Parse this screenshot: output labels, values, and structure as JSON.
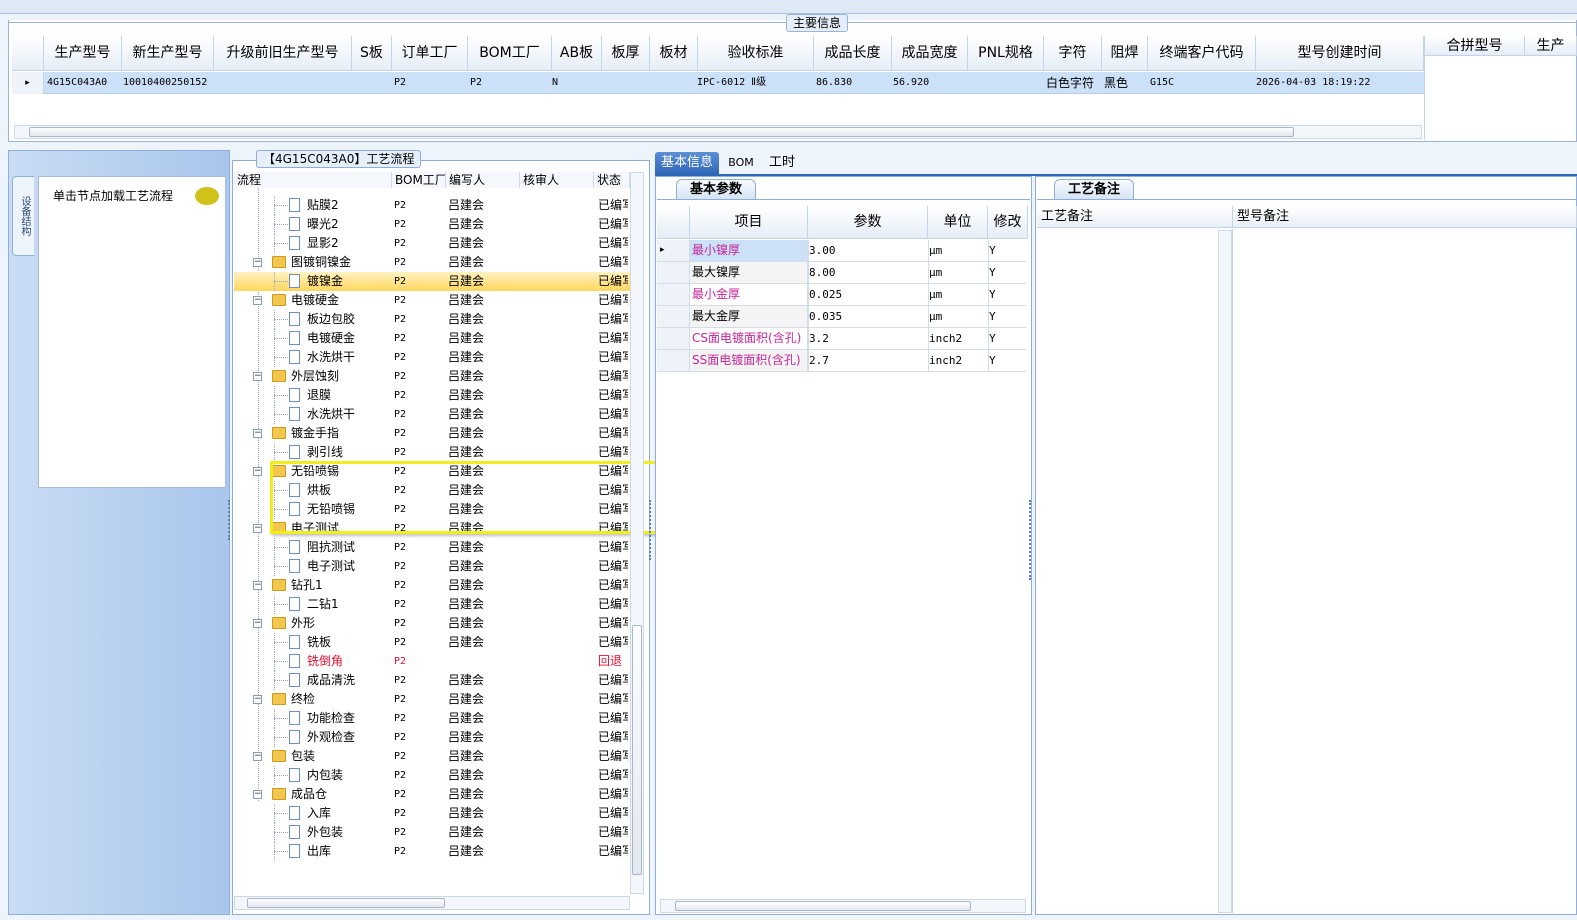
{
  "main": {
    "legend": "主要信息",
    "columns": [
      "生产型号",
      "新生产型号",
      "升级前旧生产型号",
      "S板",
      "订单工厂",
      "BOM工厂",
      "AB板",
      "板厚",
      "板材",
      "验收标准",
      "成品长度",
      "成品宽度",
      "PNL规格",
      "字符",
      "阻焊",
      "终端客户代码",
      "型号创建时间",
      "合拼型号",
      "生产"
    ],
    "row": {
      "marker": "▸",
      "prod_model": "4G15C043A0",
      "new_model": "10010400250152",
      "order_factory": "P2",
      "bom_factory": "P2",
      "ab": "N",
      "standard": "IPC-6012 Ⅱ级",
      "length": "86.830",
      "width": "56.920",
      "char": "白色字符",
      "mask": "黑色",
      "customer": "G15C",
      "created": "2026-04-03 18:19:22"
    }
  },
  "left_nav": {
    "vertical_tab": "设备结构",
    "item": "单击节点加载工艺流程"
  },
  "process": {
    "title": "【4G15C043A0】工艺流程",
    "headers": [
      "流程",
      "BOM工厂",
      "编写人",
      "核审人",
      "状态"
    ],
    "rows": [
      {
        "name": "贴膜2",
        "type": "doc",
        "level": 2,
        "factory": "P2",
        "writer": "吕建会",
        "status": "已编写"
      },
      {
        "name": "曝光2",
        "type": "doc",
        "level": 2,
        "factory": "P2",
        "writer": "吕建会",
        "status": "已编写"
      },
      {
        "name": "显影2",
        "type": "doc",
        "level": 2,
        "factory": "P2",
        "writer": "吕建会",
        "status": "已编写"
      },
      {
        "name": "图镀铜镍金",
        "type": "folder",
        "level": 1,
        "factory": "P2",
        "writer": "吕建会",
        "status": "已编写"
      },
      {
        "name": "镀镍金",
        "type": "doc",
        "level": 2,
        "factory": "P2",
        "writer": "吕建会",
        "status": "已编写",
        "selected": true
      },
      {
        "name": "电镀硬金",
        "type": "folder",
        "level": 1,
        "factory": "P2",
        "writer": "吕建会",
        "status": "已编写"
      },
      {
        "name": "板边包胶",
        "type": "doc",
        "level": 2,
        "factory": "P2",
        "writer": "吕建会",
        "status": "已编写"
      },
      {
        "name": "电镀硬金",
        "type": "doc",
        "level": 2,
        "factory": "P2",
        "writer": "吕建会",
        "status": "已编写"
      },
      {
        "name": "水洗烘干",
        "type": "doc",
        "level": 2,
        "factory": "P2",
        "writer": "吕建会",
        "status": "已编写"
      },
      {
        "name": "外层蚀刻",
        "type": "folder",
        "level": 1,
        "factory": "P2",
        "writer": "吕建会",
        "status": "已编写"
      },
      {
        "name": "退膜",
        "type": "doc",
        "level": 2,
        "factory": "P2",
        "writer": "吕建会",
        "status": "已编写"
      },
      {
        "name": "水洗烘干",
        "type": "doc",
        "level": 2,
        "factory": "P2",
        "writer": "吕建会",
        "status": "已编写"
      },
      {
        "name": "镀金手指",
        "type": "folder",
        "level": 1,
        "factory": "P2",
        "writer": "吕建会",
        "status": "已编写"
      },
      {
        "name": "剥引线",
        "type": "doc",
        "level": 2,
        "factory": "P2",
        "writer": "吕建会",
        "status": "已编写"
      },
      {
        "name": "无铅喷锡",
        "type": "folder",
        "level": 1,
        "factory": "P2",
        "writer": "吕建会",
        "status": "已编写"
      },
      {
        "name": "烘板",
        "type": "doc",
        "level": 2,
        "factory": "P2",
        "writer": "吕建会",
        "status": "已编写"
      },
      {
        "name": "无铅喷锡",
        "type": "doc",
        "level": 2,
        "factory": "P2",
        "writer": "吕建会",
        "status": "已编写"
      },
      {
        "name": "电子测试",
        "type": "folder",
        "level": 1,
        "factory": "P2",
        "writer": "吕建会",
        "status": "已编写"
      },
      {
        "name": "阻抗测试",
        "type": "doc",
        "level": 2,
        "factory": "P2",
        "writer": "吕建会",
        "status": "已编写"
      },
      {
        "name": "电子测试",
        "type": "doc",
        "level": 2,
        "factory": "P2",
        "writer": "吕建会",
        "status": "已编写"
      },
      {
        "name": "钻孔1",
        "type": "folder",
        "level": 1,
        "factory": "P2",
        "writer": "吕建会",
        "status": "已编写"
      },
      {
        "name": "二钻1",
        "type": "doc",
        "level": 2,
        "factory": "P2",
        "writer": "吕建会",
        "status": "已编写"
      },
      {
        "name": "外形",
        "type": "folder",
        "level": 1,
        "factory": "P2",
        "writer": "吕建会",
        "status": "已编写"
      },
      {
        "name": "铣板",
        "type": "doc",
        "level": 2,
        "factory": "P2",
        "writer": "吕建会",
        "status": "已编写"
      },
      {
        "name": "铣倒角",
        "type": "doc",
        "level": 2,
        "factory": "P2",
        "writer": "",
        "status": "回退",
        "red": true
      },
      {
        "name": "成品清洗",
        "type": "doc",
        "level": 2,
        "factory": "P2",
        "writer": "吕建会",
        "status": "已编写"
      },
      {
        "name": "终检",
        "type": "folder",
        "level": 1,
        "factory": "P2",
        "writer": "吕建会",
        "status": "已编写"
      },
      {
        "name": "功能检查",
        "type": "doc",
        "level": 2,
        "factory": "P2",
        "writer": "吕建会",
        "status": "已编写"
      },
      {
        "name": "外观检查",
        "type": "doc",
        "level": 2,
        "factory": "P2",
        "writer": "吕建会",
        "status": "已编写"
      },
      {
        "name": "包装",
        "type": "folder",
        "level": 1,
        "factory": "P2",
        "writer": "吕建会",
        "status": "已编写"
      },
      {
        "name": "内包装",
        "type": "doc",
        "level": 2,
        "factory": "P2",
        "writer": "吕建会",
        "status": "已编写"
      },
      {
        "name": "成品仓",
        "type": "folder",
        "level": 1,
        "factory": "P2",
        "writer": "吕建会",
        "status": "已编写"
      },
      {
        "name": "入库",
        "type": "doc",
        "level": 2,
        "factory": "P2",
        "writer": "吕建会",
        "status": "已编写"
      },
      {
        "name": "外包装",
        "type": "doc",
        "level": 2,
        "factory": "P2",
        "writer": "吕建会",
        "status": "已编写"
      },
      {
        "name": "出库",
        "type": "doc",
        "level": 2,
        "factory": "P2",
        "writer": "吕建会",
        "status": "已编写"
      }
    ]
  },
  "tabs": [
    "基本信息",
    "BOM",
    "工时"
  ],
  "params": {
    "subtab": "基本参数",
    "headers": [
      "项目",
      "参数",
      "单位",
      "修改"
    ],
    "rows": [
      {
        "item": "最小镍厚",
        "value": "3.00",
        "unit": "μm",
        "mod": "Y",
        "pink": true,
        "highlight": true
      },
      {
        "item": "最大镍厚",
        "value": "8.00",
        "unit": "μm",
        "mod": "Y",
        "pink": false
      },
      {
        "item": "最小金厚",
        "value": "0.025",
        "unit": "μm",
        "mod": "Y",
        "pink": true
      },
      {
        "item": "最大金厚",
        "value": "0.035",
        "unit": "μm",
        "mod": "Y",
        "pink": false
      },
      {
        "item": "CS面电镀面积(含孔)",
        "value": "3.2",
        "unit": "inch2",
        "mod": "Y",
        "pink": true
      },
      {
        "item": "SS面电镀面积(含孔)",
        "value": "2.7",
        "unit": "inch2",
        "mod": "Y",
        "pink": true
      }
    ]
  },
  "remarks": {
    "subtab": "工艺备注",
    "headers": [
      "工艺备注",
      "型号备注"
    ]
  },
  "colors": {
    "accent": "#2f67b8",
    "pink": "#c4269a",
    "selected": "#ffd75e",
    "highlight": "#f2ee1c",
    "red": "#e0102f"
  }
}
